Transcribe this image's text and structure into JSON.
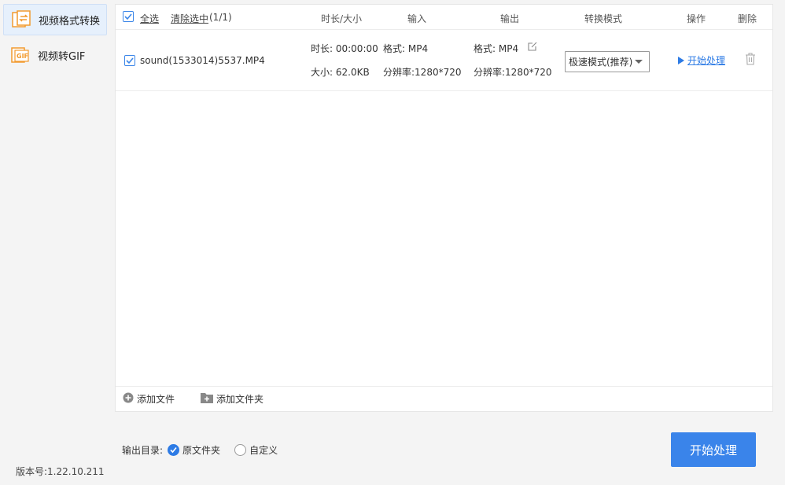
{
  "sidebar": {
    "items": [
      {
        "label": "视频格式转换",
        "icon": "convert-icon"
      },
      {
        "label": "视频转GIF",
        "icon": "gif-icon",
        "icon_text": "GIF"
      }
    ],
    "version": "版本号:1.22.10.211"
  },
  "table": {
    "select_all": "全选",
    "clear_selected": "清除选中",
    "selected_count": "(1/1)",
    "headers": {
      "duration_size": "时长/大小",
      "input": "输入",
      "output": "输出",
      "mode": "转换模式",
      "action": "操作",
      "delete": "删除"
    },
    "rows": [
      {
        "filename": "sound(1533014)5537.MP4",
        "duration": "时长: 00:00:00",
        "size": "大小: 62.0KB",
        "input_format": "格式: MP4",
        "input_resolution": "分辨率:1280*720",
        "output_format": "格式: MP4",
        "output_resolution": "分辨率:1280*720",
        "mode": "极速模式(推荐)",
        "action": "开始处理"
      }
    ]
  },
  "footer": {
    "add_file": "添加文件",
    "add_folder": "添加文件夹"
  },
  "output": {
    "label": "输出目录:",
    "options": [
      "原文件夹",
      "自定义"
    ],
    "selected": "原文件夹"
  },
  "start_button": "开始处理",
  "colors": {
    "accent": "#3a84ea",
    "link": "#2d7be5",
    "icon_orange": "#f29a2e"
  }
}
